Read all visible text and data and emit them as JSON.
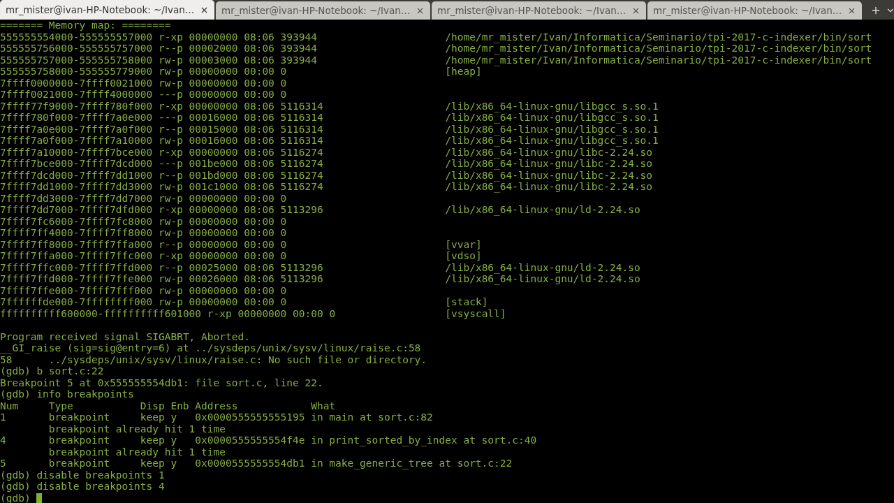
{
  "tabs": [
    {
      "title": "mr_mister@ivan-HP-Notebook: ~/Ivan…",
      "selected": true
    },
    {
      "title": "mr_mister@ivan-HP-Notebook: ~/Ivan…",
      "selected": false
    },
    {
      "title": "mr_mister@ivan-HP-Notebook: ~/Ivan…",
      "selected": false
    },
    {
      "title": "mr_mister@ivan-HP-Notebook: ~/Ivan…",
      "selected": false
    }
  ],
  "terminal": {
    "lines": [
      {
        "kind": "text",
        "text": "======= Memory map: ========"
      },
      {
        "kind": "mapping",
        "text": "555555554000-555555557000 r-xp 00000000 08:06 393944",
        "path": "/home/mr_mister/Ivan/Informatica/Seminario/tpi-2017-c-indexer/bin/sort"
      },
      {
        "kind": "mapping",
        "text": "555555756000-555555757000 r--p 00002000 08:06 393944",
        "path": "/home/mr_mister/Ivan/Informatica/Seminario/tpi-2017-c-indexer/bin/sort"
      },
      {
        "kind": "mapping",
        "text": "555555757000-555555758000 rw-p 00003000 08:06 393944",
        "path": "/home/mr_mister/Ivan/Informatica/Seminario/tpi-2017-c-indexer/bin/sort"
      },
      {
        "kind": "mapping",
        "text": "555555758000-555555779000 rw-p 00000000 00:00 0",
        "path": "[heap]"
      },
      {
        "kind": "mapping",
        "text": "7ffff0000000-7ffff0021000 rw-p 00000000 00:00 0"
      },
      {
        "kind": "mapping",
        "text": "7ffff0021000-7ffff4000000 ---p 00000000 00:00 0"
      },
      {
        "kind": "mapping",
        "text": "7ffff77f9000-7ffff780f000 r-xp 00000000 08:06 5116314",
        "path": "/lib/x86_64-linux-gnu/libgcc_s.so.1"
      },
      {
        "kind": "mapping",
        "text": "7ffff780f000-7ffff7a0e000 ---p 00016000 08:06 5116314",
        "path": "/lib/x86_64-linux-gnu/libgcc_s.so.1"
      },
      {
        "kind": "mapping",
        "text": "7ffff7a0e000-7ffff7a0f000 r--p 00015000 08:06 5116314",
        "path": "/lib/x86_64-linux-gnu/libgcc_s.so.1"
      },
      {
        "kind": "mapping",
        "text": "7ffff7a0f000-7ffff7a10000 rw-p 00016000 08:06 5116314",
        "path": "/lib/x86_64-linux-gnu/libgcc_s.so.1"
      },
      {
        "kind": "mapping",
        "text": "7ffff7a10000-7ffff7bce000 r-xp 00000000 08:06 5116274",
        "path": "/lib/x86_64-linux-gnu/libc-2.24.so"
      },
      {
        "kind": "mapping",
        "text": "7ffff7bce000-7ffff7dcd000 ---p 001be000 08:06 5116274",
        "path": "/lib/x86_64-linux-gnu/libc-2.24.so"
      },
      {
        "kind": "mapping",
        "text": "7ffff7dcd000-7ffff7dd1000 r--p 001bd000 08:06 5116274",
        "path": "/lib/x86_64-linux-gnu/libc-2.24.so"
      },
      {
        "kind": "mapping",
        "text": "7ffff7dd1000-7ffff7dd3000 rw-p 001c1000 08:06 5116274",
        "path": "/lib/x86_64-linux-gnu/libc-2.24.so"
      },
      {
        "kind": "mapping",
        "text": "7ffff7dd3000-7ffff7dd7000 rw-p 00000000 00:00 0"
      },
      {
        "kind": "mapping",
        "text": "7ffff7dd7000-7ffff7dfd000 r-xp 00000000 08:06 5113296",
        "path": "/lib/x86_64-linux-gnu/ld-2.24.so"
      },
      {
        "kind": "mapping",
        "text": "7ffff7fc6000-7ffff7fc8000 rw-p 00000000 00:00 0"
      },
      {
        "kind": "mapping",
        "text": "7ffff7ff4000-7ffff7ff8000 rw-p 00000000 00:00 0"
      },
      {
        "kind": "mapping",
        "text": "7ffff7ff8000-7ffff7ffa000 r--p 00000000 00:00 0",
        "path": "[vvar]"
      },
      {
        "kind": "mapping",
        "text": "7ffff7ffa000-7ffff7ffc000 r-xp 00000000 00:00 0",
        "path": "[vdso]"
      },
      {
        "kind": "mapping",
        "text": "7ffff7ffc000-7ffff7ffd000 r--p 00025000 08:06 5113296",
        "path": "/lib/x86_64-linux-gnu/ld-2.24.so"
      },
      {
        "kind": "mapping",
        "text": "7ffff7ffd000-7ffff7ffe000 rw-p 00026000 08:06 5113296",
        "path": "/lib/x86_64-linux-gnu/ld-2.24.so"
      },
      {
        "kind": "mapping",
        "text": "7ffff7ffe000-7ffff7fff000 rw-p 00000000 00:00 0"
      },
      {
        "kind": "mapping",
        "text": "7ffffffde000-7ffffffff000 rw-p 00000000 00:00 0",
        "path": "[stack]"
      },
      {
        "kind": "mapping",
        "text": "ffffffffff600000-ffffffffff601000 r-xp 00000000 00:00 0",
        "path": "[vsyscall]"
      },
      {
        "kind": "blank"
      },
      {
        "kind": "text",
        "text": "Program received signal SIGABRT, Aborted."
      },
      {
        "kind": "text",
        "text": "__GI_raise (sig=sig@entry=6) at ../sysdeps/unix/sysv/linux/raise.c:58"
      },
      {
        "kind": "source",
        "line_number": "58",
        "text": "../sysdeps/unix/sysv/linux/raise.c: No such file or directory."
      },
      {
        "kind": "text",
        "text": "(gdb) b sort.c:22"
      },
      {
        "kind": "text",
        "text": "Breakpoint 5 at 0x555555554db1: file sort.c, line 22."
      },
      {
        "kind": "text",
        "text": "(gdb) info breakpoints"
      },
      {
        "kind": "table_row",
        "cells": [
          "Num",
          "Type",
          "Disp",
          "Enb",
          "Address",
          "What"
        ]
      },
      {
        "kind": "table_row",
        "cells": [
          "1",
          "breakpoint",
          "keep",
          "y",
          "0x0000555555555195",
          "in main at sort.c:82"
        ]
      },
      {
        "kind": "note",
        "text": "breakpoint already hit 1 time"
      },
      {
        "kind": "table_row",
        "cells": [
          "4",
          "breakpoint",
          "keep",
          "y",
          "0x0000555555554f4e",
          "in print_sorted_by_index at sort.c:40"
        ]
      },
      {
        "kind": "note",
        "text": "breakpoint already hit 1 time"
      },
      {
        "kind": "table_row",
        "cells": [
          "5",
          "breakpoint",
          "keep",
          "y",
          "0x0000555555554db1",
          "in make_generic_tree at sort.c:22"
        ]
      },
      {
        "kind": "text",
        "text": "(gdb) disable breakpoints 1"
      },
      {
        "kind": "text",
        "text": "(gdb) disable breakpoints 4"
      },
      {
        "kind": "prompt",
        "text": "(gdb)"
      }
    ]
  }
}
